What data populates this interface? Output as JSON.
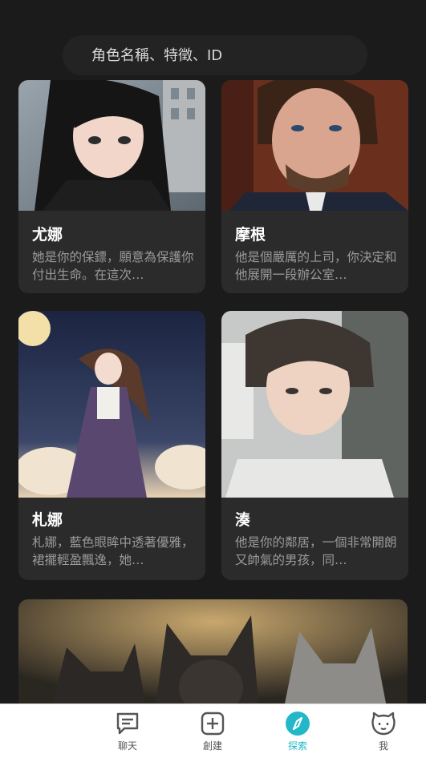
{
  "search": {
    "placeholder": "角色名稱、特徵、ID"
  },
  "cards": [
    {
      "name": "尤娜",
      "desc": "她是你的保鏢，願意為保護你付出生命。在這次…"
    },
    {
      "name": "摩根",
      "desc": "他是個嚴厲的上司，你決定和他展開一段辦公室…"
    },
    {
      "name": "札娜",
      "desc": "札娜，藍色眼眸中透著優雅，裙擺輕盈飄逸，她…"
    },
    {
      "name": "湊",
      "desc": "他是你的鄰居，一個非常開朗又帥氣的男孩，同…"
    }
  ],
  "tabs": [
    {
      "label": "聊天",
      "icon": "chat-icon"
    },
    {
      "label": "創建",
      "icon": "plus-square-icon"
    },
    {
      "label": "探索",
      "icon": "compass-icon"
    },
    {
      "label": "我",
      "icon": "cat-face-icon"
    }
  ],
  "colors": {
    "accent": "#22b8c8",
    "background": "#1b1b1b",
    "card": "#2b2b2b"
  }
}
